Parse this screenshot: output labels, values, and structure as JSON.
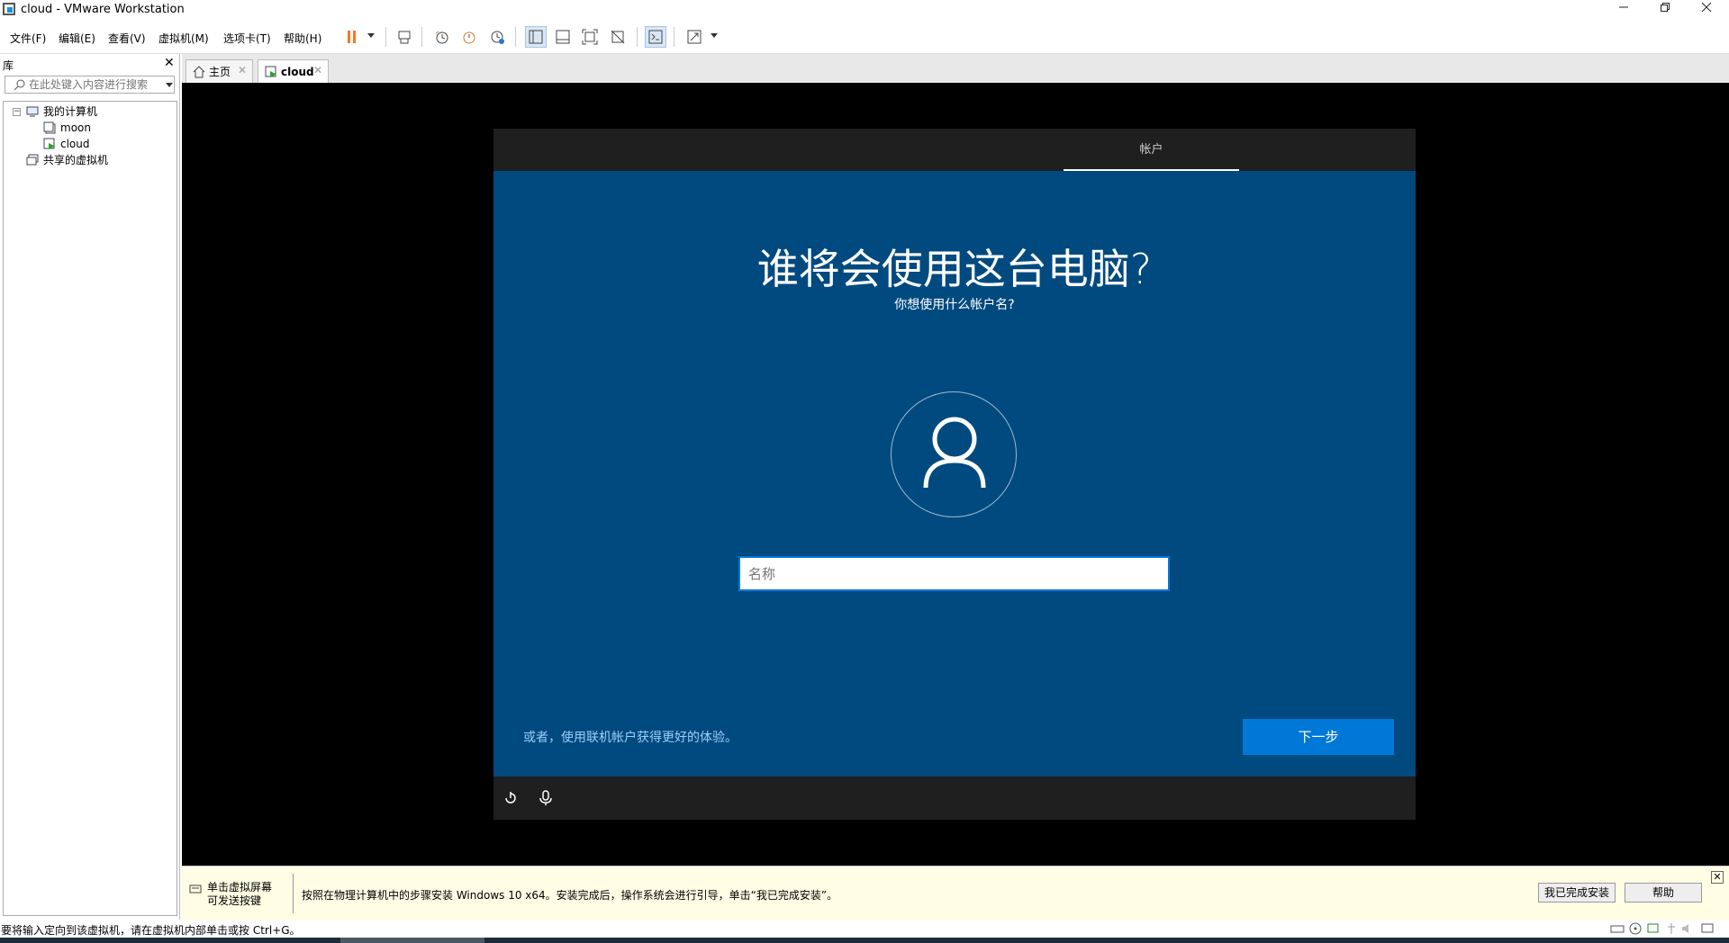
{
  "window": {
    "title": "cloud - VMware Workstation"
  },
  "menu": {
    "items": [
      "文件(F)",
      "编辑(E)",
      "查看(V)",
      "虚拟机(M)",
      "选项卡(T)",
      "帮助(H)"
    ]
  },
  "toolbar": {
    "icons": [
      "pause-icon",
      "send-ctrl-alt-del-icon",
      "snapshot-icon",
      "revert-snapshot-icon",
      "snapshot-manager-icon",
      "library-view-icon",
      "thumbnail-bar-icon",
      "full-screen-icon",
      "unity-icon",
      "console-icon",
      "stretch-icon"
    ]
  },
  "library": {
    "title": "库",
    "search_placeholder": "在此处键入内容进行搜索",
    "tree": {
      "my_computer": "我的计算机",
      "vms": [
        "moon",
        "cloud"
      ],
      "shared": "共享的虚拟机"
    }
  },
  "tabs": [
    {
      "label": "主页"
    },
    {
      "label": "cloud"
    }
  ],
  "oobe": {
    "tab": "帐户",
    "title": "谁将会使用这台电脑?",
    "subtitle": "你想使用什么帐户名?",
    "name_placeholder": "名称",
    "online_link": "或者，使用联机帐户获得更好的体验。",
    "next_button": "下一步"
  },
  "hint": {
    "left_line1": "单击虚拟屏幕",
    "left_line2": "可发送按键",
    "message": "按照在物理计算机中的步骤安装 Windows 10 x64。安装完成后，操作系统会进行引导，单击“我已完成安装”。",
    "done_button": "我已完成安装",
    "help_button": "帮助"
  },
  "status": {
    "text": "要将输入定向到该虚拟机，请在虚拟机内部单击或按 Ctrl+G。"
  },
  "colors": {
    "oobe_blue": "#004a7f",
    "accent": "#0078d7",
    "pause_orange": "#f47a20"
  }
}
